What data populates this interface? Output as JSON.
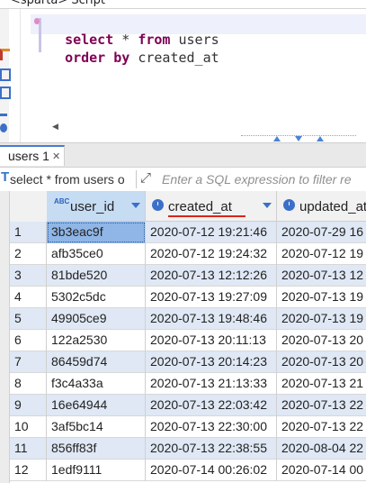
{
  "editor_tab": {
    "label": "<sparta> Script"
  },
  "editor": {
    "line1": {
      "kw1": "select",
      "rest1": " * ",
      "kw2": "from",
      "rest2": " users"
    },
    "line2": {
      "kw1": "order by",
      "rest1": " created_at"
    }
  },
  "results_tab": {
    "label": "users 1",
    "close": "✕"
  },
  "filter": {
    "sql_text": "select * from users o",
    "placeholder": "Enter a SQL expression to filter re"
  },
  "grid": {
    "columns": [
      {
        "label": "user_id",
        "type_icon": "abc-type-icon"
      },
      {
        "label": "created_at",
        "type_icon": "clock-type-icon"
      },
      {
        "label": "updated_at",
        "type_icon": "clock-type-icon"
      }
    ],
    "rows": [
      {
        "num": "1",
        "user_id": "3b3eac9f",
        "created_at": "2020-07-12 19:21:46",
        "updated_at": "2020-07-29 16"
      },
      {
        "num": "2",
        "user_id": "afb35ce0",
        "created_at": "2020-07-12 19:24:32",
        "updated_at": "2020-07-12 19"
      },
      {
        "num": "3",
        "user_id": "81bde520",
        "created_at": "2020-07-13 12:12:26",
        "updated_at": "2020-07-13 12"
      },
      {
        "num": "4",
        "user_id": "5302c5dc",
        "created_at": "2020-07-13 19:27:09",
        "updated_at": "2020-07-13 19"
      },
      {
        "num": "5",
        "user_id": "49905ce9",
        "created_at": "2020-07-13 19:48:46",
        "updated_at": "2020-07-13 19"
      },
      {
        "num": "6",
        "user_id": "122a2530",
        "created_at": "2020-07-13 20:11:13",
        "updated_at": "2020-07-13 20"
      },
      {
        "num": "7",
        "user_id": "86459d74",
        "created_at": "2020-07-13 20:14:23",
        "updated_at": "2020-07-13 20"
      },
      {
        "num": "8",
        "user_id": "f3c4a33a",
        "created_at": "2020-07-13 21:13:33",
        "updated_at": "2020-07-13 21"
      },
      {
        "num": "9",
        "user_id": "16e64944",
        "created_at": "2020-07-13 22:03:42",
        "updated_at": "2020-07-13 22"
      },
      {
        "num": "10",
        "user_id": "3af5bc14",
        "created_at": "2020-07-13 22:30:00",
        "updated_at": "2020-07-13 22"
      },
      {
        "num": "11",
        "user_id": "856ff83f",
        "created_at": "2020-07-13 22:38:55",
        "updated_at": "2020-08-04 22"
      },
      {
        "num": "12",
        "user_id": "1edf9111",
        "created_at": "2020-07-14 00:26:02",
        "updated_at": "2020-07-14 00"
      }
    ]
  },
  "colors": {
    "keyword": "#7f0055",
    "accent": "#3b6fc9",
    "row_stripe": "#dfe8f4",
    "selected_cell": "#8fb6e6",
    "annotation_underline": "#d9241b"
  }
}
